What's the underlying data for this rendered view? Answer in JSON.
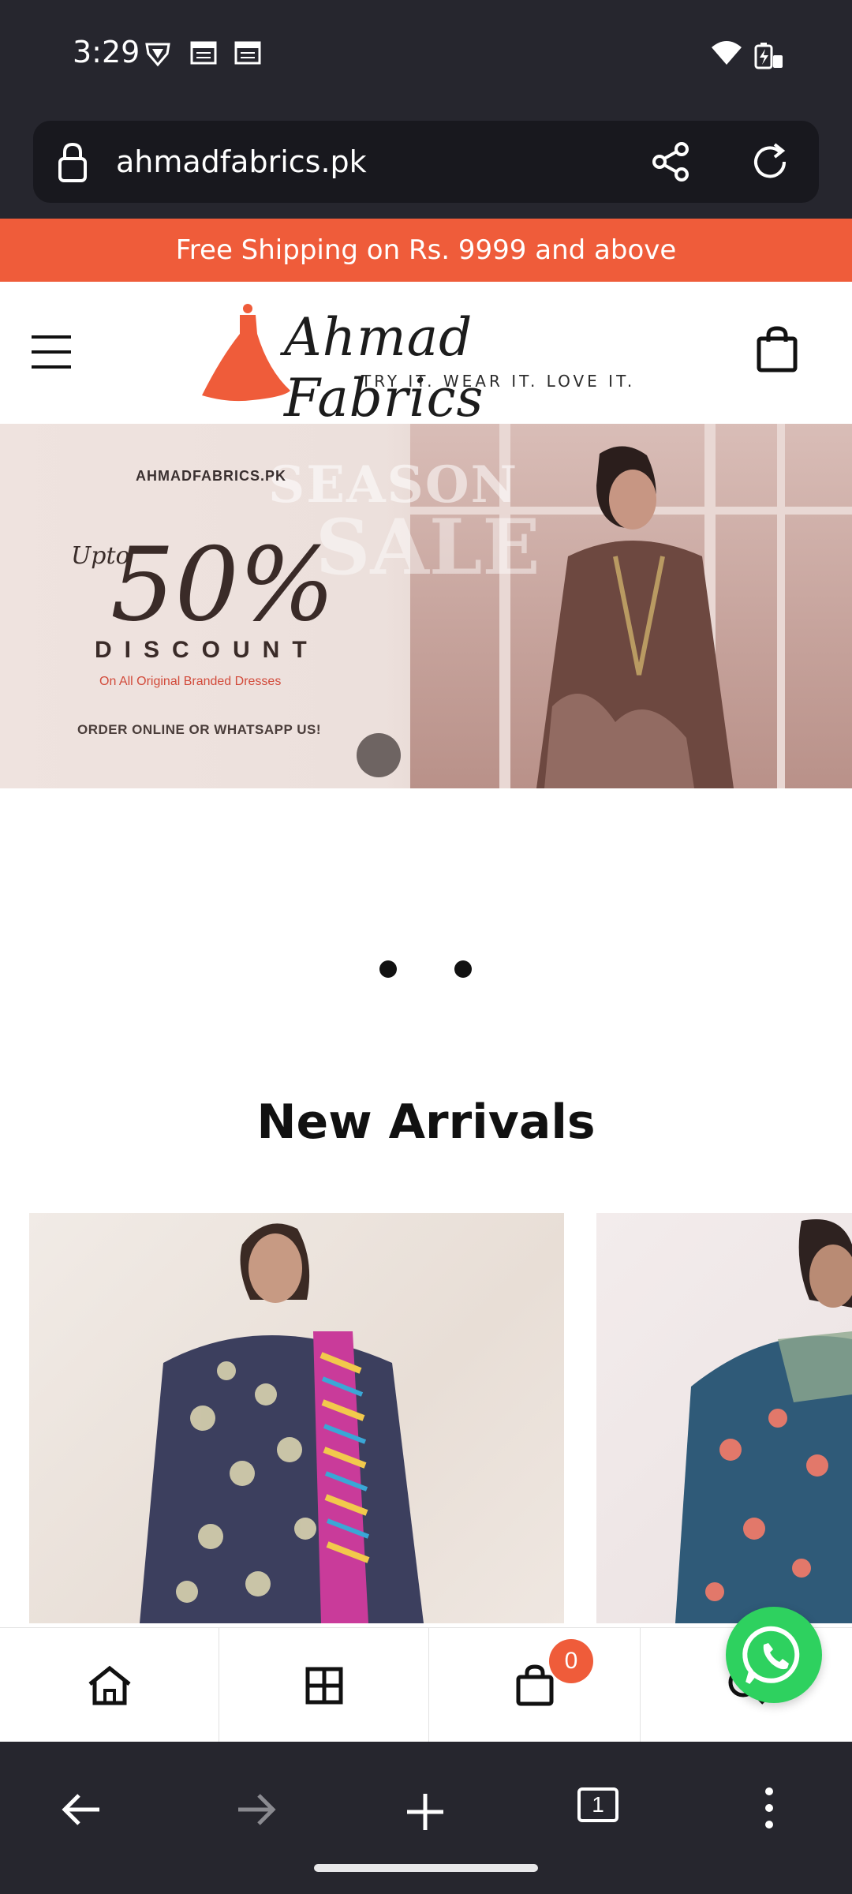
{
  "status_bar": {
    "time": "3:29",
    "icons": [
      "vpn-shield-icon",
      "calendar-icon",
      "calendar-icon",
      "wifi-icon",
      "battery-charging-icon"
    ]
  },
  "browser": {
    "url": "ahmadfabrics.pk",
    "icons": [
      "lock-icon",
      "share-icon",
      "reload-icon"
    ],
    "bottom_bar": {
      "icons": [
        "back-arrow-icon",
        "forward-arrow-icon",
        "new-tab-plus-icon",
        "tab-count-icon",
        "more-vertical-icon"
      ],
      "tab_count": "1"
    }
  },
  "site": {
    "promo_text": "Free Shipping on Rs. 9999 and above",
    "logo": {
      "name": "Ahmad Fabrics",
      "tagline": "TRY IT. WEAR IT. LOVE IT."
    },
    "banner": {
      "site": "AHMADFABRICS.PK",
      "upto": "Upto",
      "percent": "50%",
      "discount": "DISCOUNT",
      "subtitle": "On All Original Branded Dresses",
      "cta": "ORDER ONLINE OR WHATSAPP US!",
      "bg_text_season": "SEASON",
      "bg_text_sale": "SALE"
    },
    "section_title": "New Arrivals",
    "shop_nav": {
      "icons": [
        "home-icon",
        "grid-icon",
        "cart-icon",
        "search-icon"
      ],
      "cart_count": "0"
    }
  },
  "colors": {
    "accent": "#ef5c3a",
    "whatsapp": "#2ed15f",
    "browser_chrome": "#26262e"
  }
}
